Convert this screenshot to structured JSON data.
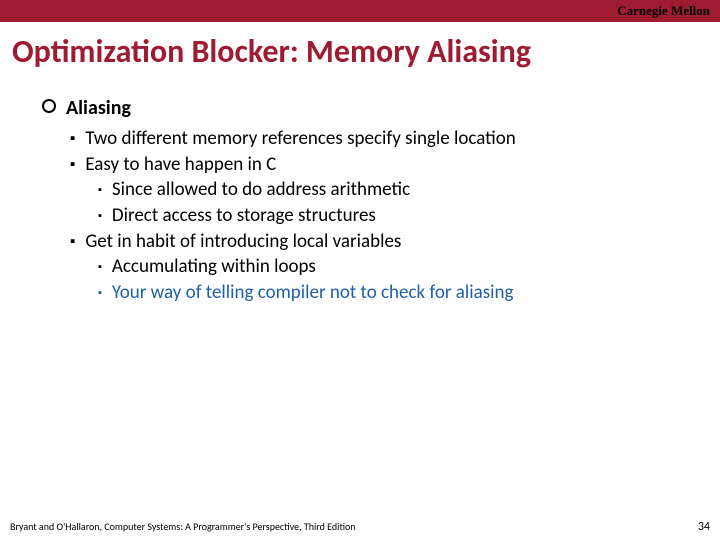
{
  "brand": "Carnegie Mellon",
  "title": "Optimization Blocker: Memory Aliasing",
  "heading": "Aliasing",
  "bullets": {
    "b1": "Two different memory references specify single location",
    "b2": "Easy to have happen in C",
    "b2a": "Since allowed to do address arithmetic",
    "b2b": "Direct access to storage structures",
    "b3": "Get in habit of introducing local variables",
    "b3a": "Accumulating within loops",
    "b3b": "Your way of telling compiler not to check for aliasing"
  },
  "footer": "Bryant and O'Hallaron, Computer Systems: A Programmer's Perspective, Third Edition",
  "page": "34"
}
